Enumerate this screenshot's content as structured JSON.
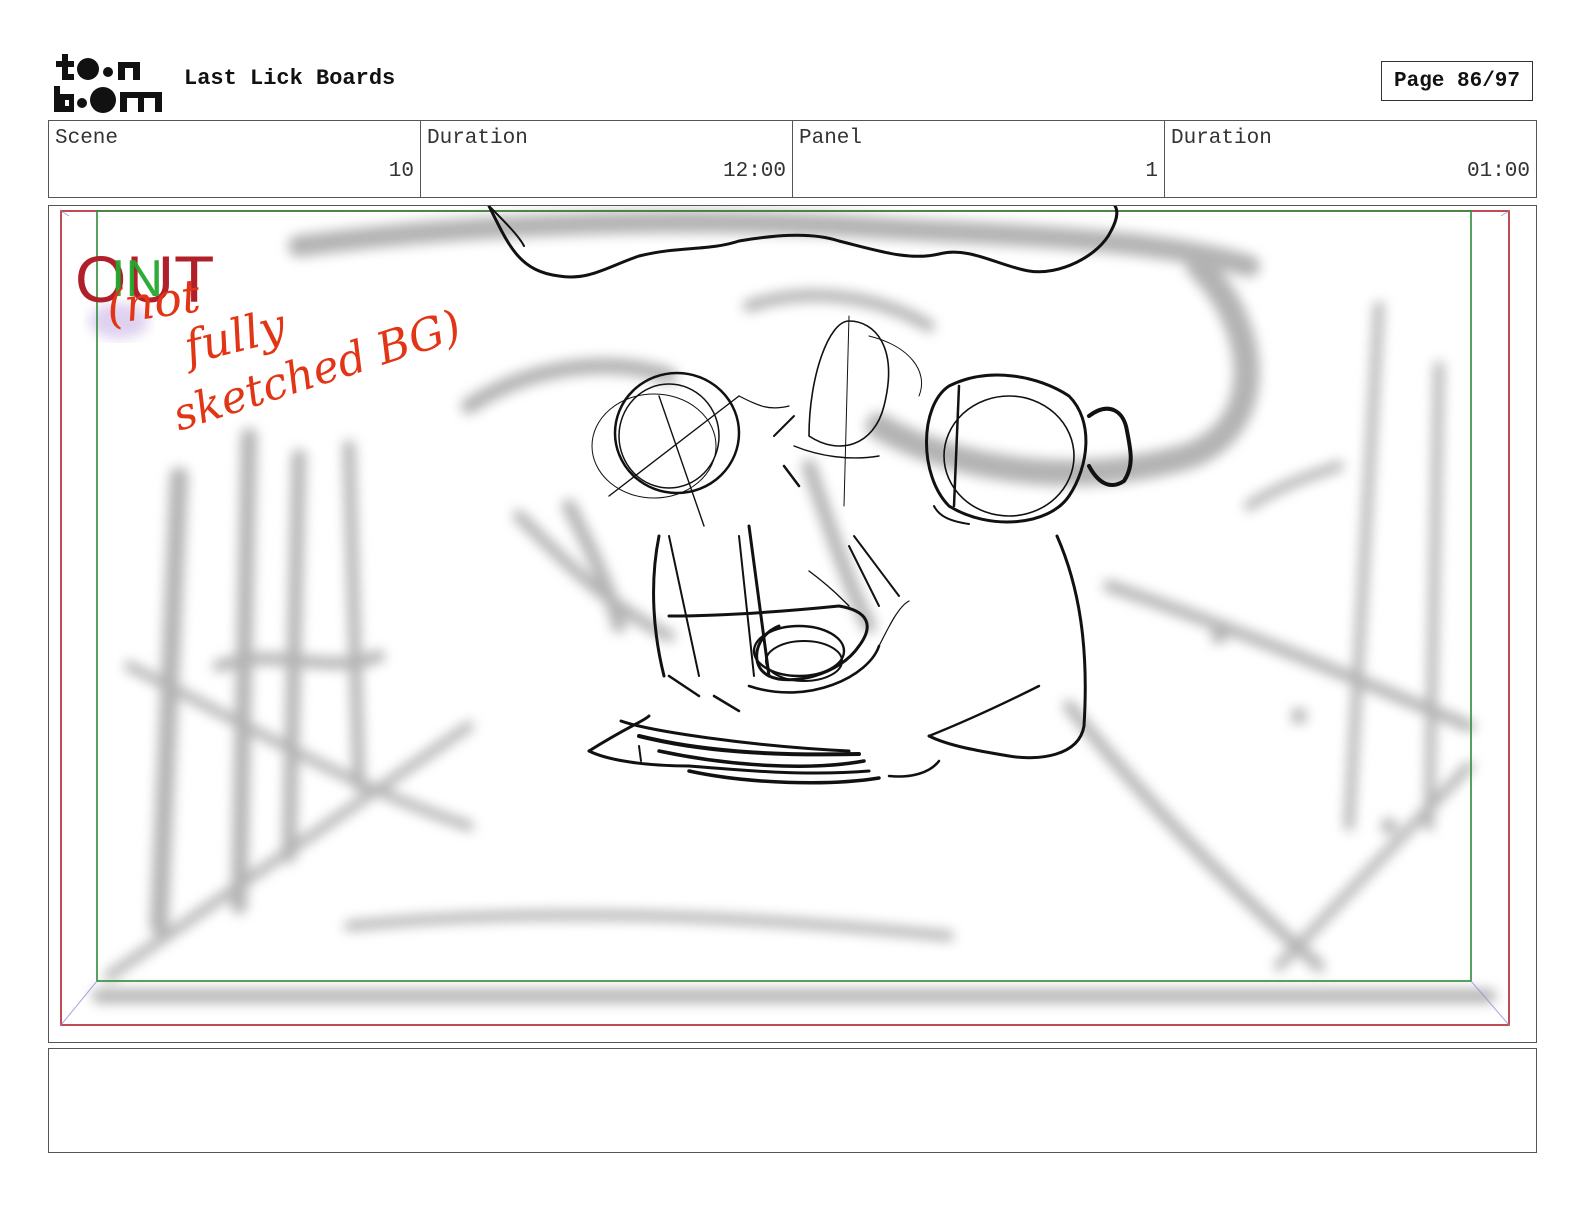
{
  "header": {
    "logo_text": "toon boom",
    "title": "Last Lick Boards",
    "page_label": "Page 86/97"
  },
  "info": {
    "scene_label": "Scene",
    "scene_value": "10",
    "scene_duration_label": "Duration",
    "scene_duration_value": "12:00",
    "panel_label": "Panel",
    "panel_value": "1",
    "panel_duration_label": "Duration",
    "panel_duration_value": "01:00"
  },
  "panel": {
    "transition_out": "OUT",
    "transition_in": "IN",
    "note_line1": "(not",
    "note_line2": "fully",
    "note_line3": "sketched BG)"
  },
  "caption": {
    "text": ""
  },
  "colors": {
    "safe_frame": "#b0202a",
    "action_frame": "#2f8a3a",
    "sketch_lines": "#111111",
    "background_blur": "#9a9a9a",
    "annotation": "#e23515"
  }
}
